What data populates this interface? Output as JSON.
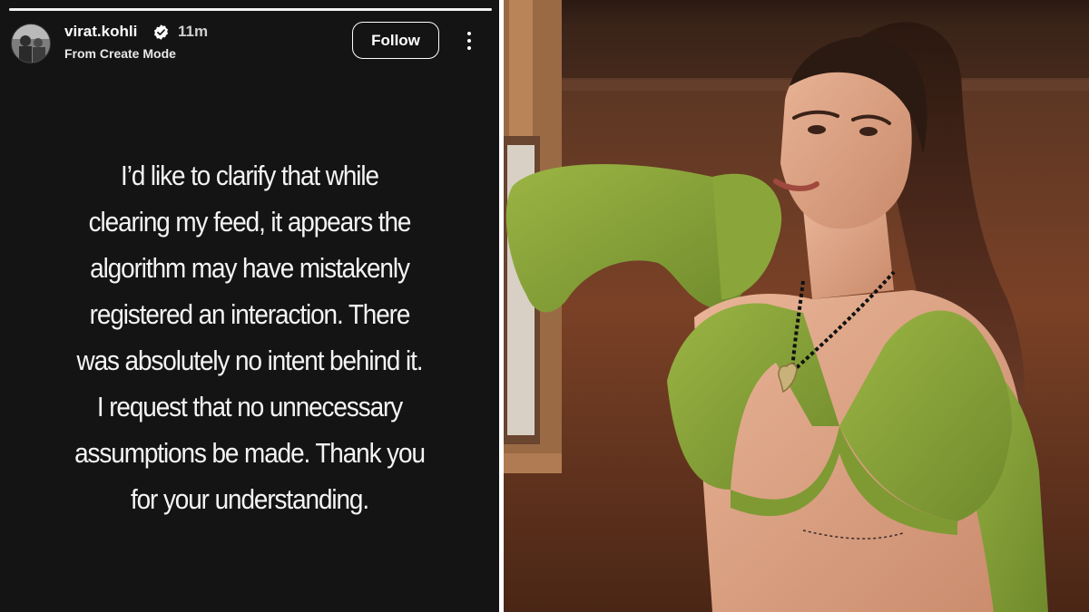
{
  "story": {
    "progress": 1.0,
    "user": {
      "username": "virat.kohli",
      "verified": true,
      "time_ago": "11m",
      "subtitle": "From Create Mode",
      "avatar": "profile-photo"
    },
    "actions": {
      "follow_label": "Follow",
      "more_icon": "more-vertical-icon"
    },
    "message_lines": [
      "I’d like to clarify that while",
      "clearing my feed, it appears the",
      "algorithm may have mistakenly",
      "registered an interaction. There",
      "was absolutely no intent behind it.",
      "I request that no unnecessary",
      "assumptions be made. Thank you",
      "for your understanding."
    ],
    "colors": {
      "background": "#141414",
      "text": "#f4f4f4"
    }
  },
  "photo": {
    "subject": "woman-in-green-crop-top",
    "colors": {
      "outfit": "#8aa33a",
      "background": "#5c301b"
    }
  }
}
